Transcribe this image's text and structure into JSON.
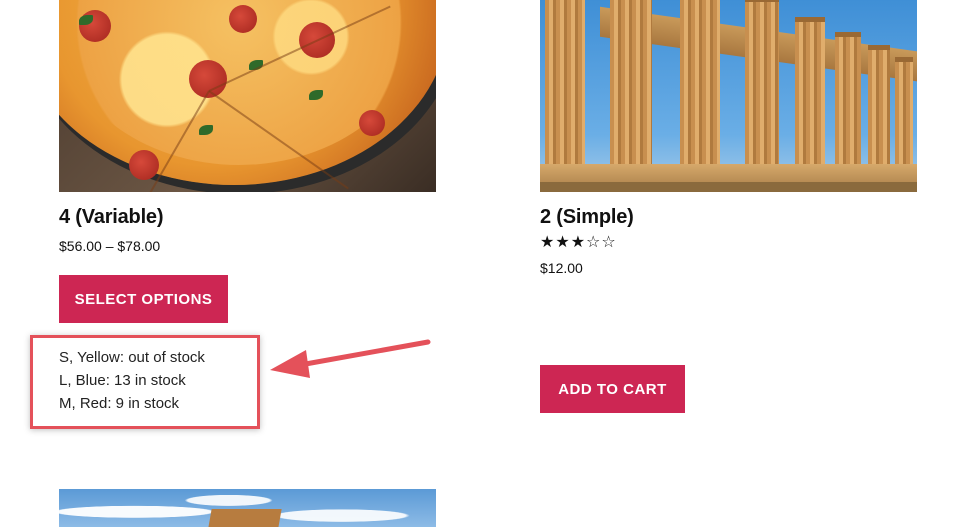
{
  "products": [
    {
      "title": "4 (Variable)",
      "price": "$56.00 – $78.00",
      "button_label": "SELECT OPTIONS",
      "image": "pizza-image",
      "stock": [
        "S, Yellow: out of stock",
        "L, Blue: 13 in stock",
        "M, Red: 9 in stock"
      ]
    },
    {
      "title": "2 (Simple)",
      "price": "$12.00",
      "button_label": "ADD TO CART",
      "image": "temple-image",
      "rating": 3,
      "rating_max": 5
    },
    {
      "image": "sky-building-image"
    }
  ],
  "colors": {
    "button": "#cd2653",
    "annotation": "#e4515a"
  }
}
